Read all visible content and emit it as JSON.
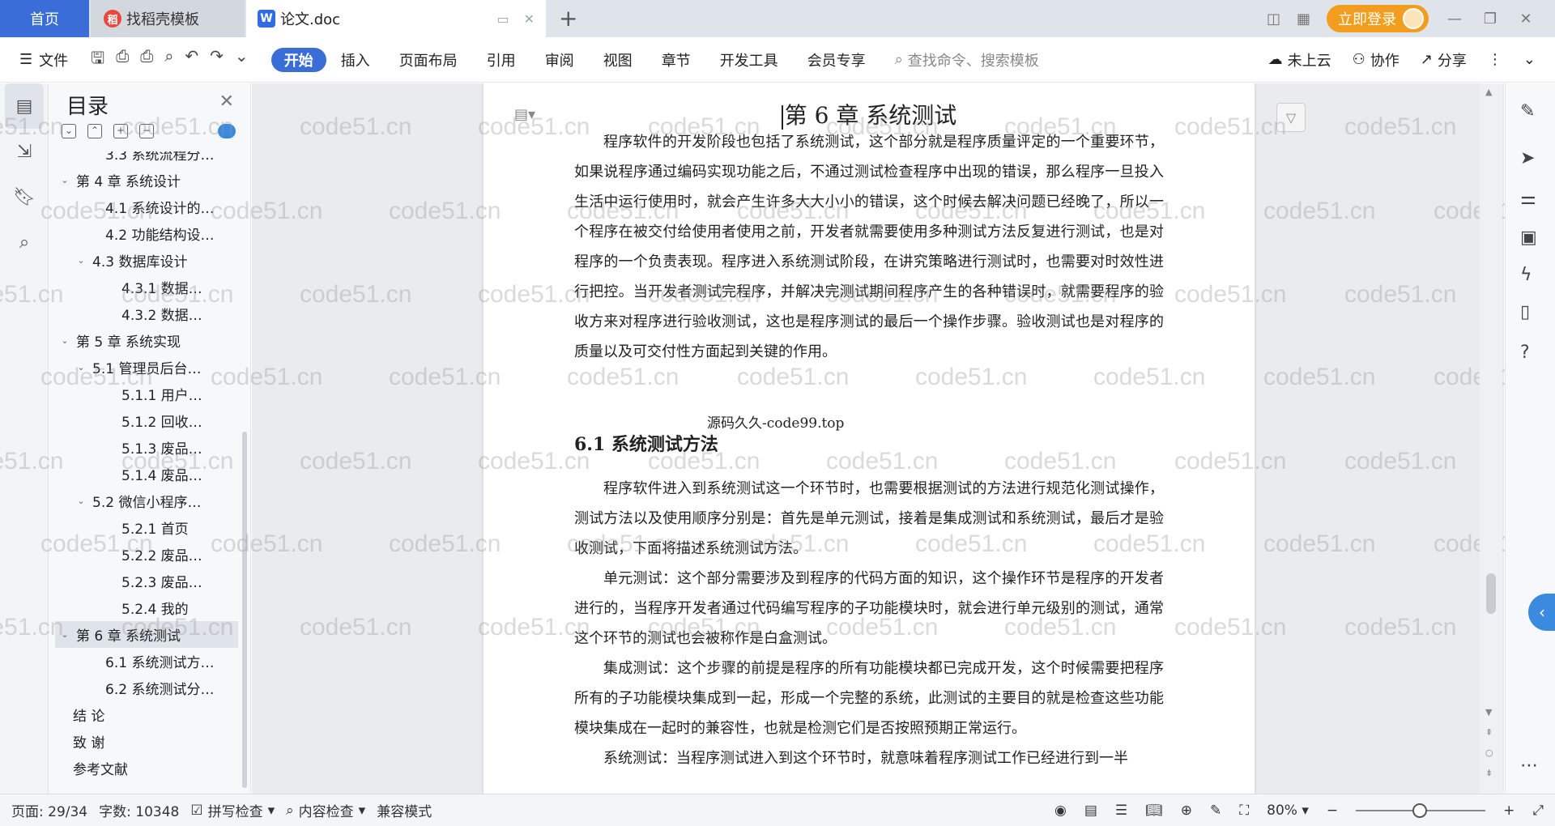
{
  "tabs": {
    "home": "首页",
    "daoke": "找稻壳模板",
    "doc": "论文.doc",
    "add": "+"
  },
  "titlebar": {
    "login": "立即登录"
  },
  "menu": {
    "file": "文件",
    "tabs": [
      "开始",
      "插入",
      "页面布局",
      "引用",
      "审阅",
      "视图",
      "章节",
      "开发工具",
      "会员专享"
    ],
    "search_placeholder": "查找命令、搜索模板",
    "cloud": "未上云",
    "collab": "协作",
    "share": "分享"
  },
  "toc": {
    "title": "目录",
    "items": [
      {
        "label": "3.3 系统流程分…",
        "level": 2
      },
      {
        "label": "第 4 章  系统设计",
        "level": 0,
        "chev": "v"
      },
      {
        "label": "4.1  系统设计的…",
        "level": 2
      },
      {
        "label": "4.2  功能结构设…",
        "level": 2
      },
      {
        "label": "4.3  数据库设计",
        "level": 1,
        "chev": "v"
      },
      {
        "label": "4.3.1  数据…",
        "level": 3
      },
      {
        "label": "4.3.2  数据…",
        "level": 3
      },
      {
        "label": "第 5 章  系统实现",
        "level": 0,
        "chev": "v"
      },
      {
        "label": "5.1 管理员后台…",
        "level": 1,
        "chev": "v"
      },
      {
        "label": "5.1.1  用户…",
        "level": 3
      },
      {
        "label": "5.1.2  回收…",
        "level": 3
      },
      {
        "label": "5.1.3  废品…",
        "level": 3
      },
      {
        "label": "5.1.4  废品…",
        "level": 3
      },
      {
        "label": "5.2  微信小程序…",
        "level": 1,
        "chev": "v"
      },
      {
        "label": "5.2.1  首页",
        "level": 3
      },
      {
        "label": "5.2.2  废品…",
        "level": 3
      },
      {
        "label": "5.2.3  废品…",
        "level": 3
      },
      {
        "label": "5.2.4  我的",
        "level": 3
      },
      {
        "label": "第 6 章  系统测试",
        "level": 0,
        "chev": "v",
        "active": true
      },
      {
        "label": "6.1 系统测试方…",
        "level": 2
      },
      {
        "label": "6.2  系统测试分…",
        "level": 2
      },
      {
        "label": "结    论",
        "level": 0
      },
      {
        "label": "致    谢",
        "level": 0
      },
      {
        "label": "参考文献",
        "level": 0
      }
    ]
  },
  "document": {
    "chapter_title": "第 6 章  系统测试",
    "para1": "程序软件的开发阶段也包括了系统测试，这个部分就是程序质量评定的一个重要环节，如果说程序通过编码实现功能之后，不通过测试检查程序中出现的错误，那么程序一旦投入生活中运行使用时，就会产生许多大大小小的错误，这个时候去解决问题已经晚了，所以一个程序在被交付给使用者使用之前，开发者就需要使用多种测试方法反复进行测试，也是对程序的一个负责表现。程序进入系统测试阶段，在讲究策略进行测试时，也需要对时效性进行把控。当开发者测试完程序，并解决完测试期间程序产生的各种错误时，就需要程序的验收方来对程序进行验收测试，这也是程序测试的最后一个操作步骤。验收测试也是对程序的质量以及可交付性方面起到关键的作用。",
    "source_note": "源码久久-code99.top",
    "section_title": "6.1 系统测试方法",
    "para2": "程序软件进入到系统测试这一个环节时，也需要根据测试的方法进行规范化测试操作，测试方法以及使用顺序分别是：首先是单元测试，接着是集成测试和系统测试，最后才是验收测试，下面将描述系统测试方法。",
    "para3": "单元测试：这个部分需要涉及到程序的代码方面的知识，这个操作环节是程序的开发者进行的，当程序开发者通过代码编写程序的子功能模块时，就会进行单元级别的测试，通常这个环节的测试也会被称作是白盒测试。",
    "para4": "集成测试：这个步骤的前提是程序的所有功能模块都已完成开发，这个时候需要把程序所有的子功能模块集成到一起，形成一个完整的系统，此测试的主要目的就是检查这些功能模块集成在一起时的兼容性，也就是检测它们是否按照预期正常运行。",
    "para5": "系统测试：当程序测试进入到这个环节时，就意味着程序测试工作已经进行到一半"
  },
  "watermark": "code51.cn",
  "status": {
    "page": "页面: 29/34",
    "words": "字数: 10348",
    "spell": "拼写检查",
    "content": "内容检查",
    "compat": "兼容模式",
    "zoom": "80%"
  }
}
